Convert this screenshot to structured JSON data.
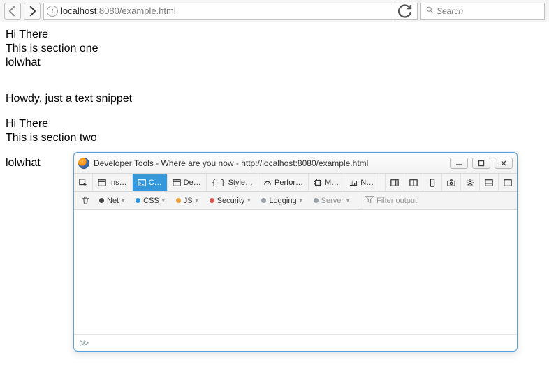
{
  "browser": {
    "url_host": "localhost",
    "url_rest": ":8080/example.html",
    "search_placeholder": "Search"
  },
  "page": {
    "s1l1": "Hi There",
    "s1l2": "This is section one",
    "s1l3": "lolwhat",
    "snippet": "Howdy, just a text snippet",
    "s2l1": "Hi There",
    "s2l2": "This is section two",
    "s2l3": "lolwhat"
  },
  "devtools": {
    "title": "Developer Tools - Where are you now - http://localhost:8080/example.html",
    "tabs": {
      "inspector": "Ins…",
      "console": "C…",
      "debugger": "De…",
      "style": "Style…",
      "performance": "Perfor…",
      "memory": "M…",
      "network": "N…"
    },
    "filters": {
      "net": "Net",
      "css": "CSS",
      "js": "JS",
      "security": "Security",
      "logging": "Logging",
      "server": "Server",
      "out": "Filter output"
    },
    "prompt": "≫"
  }
}
